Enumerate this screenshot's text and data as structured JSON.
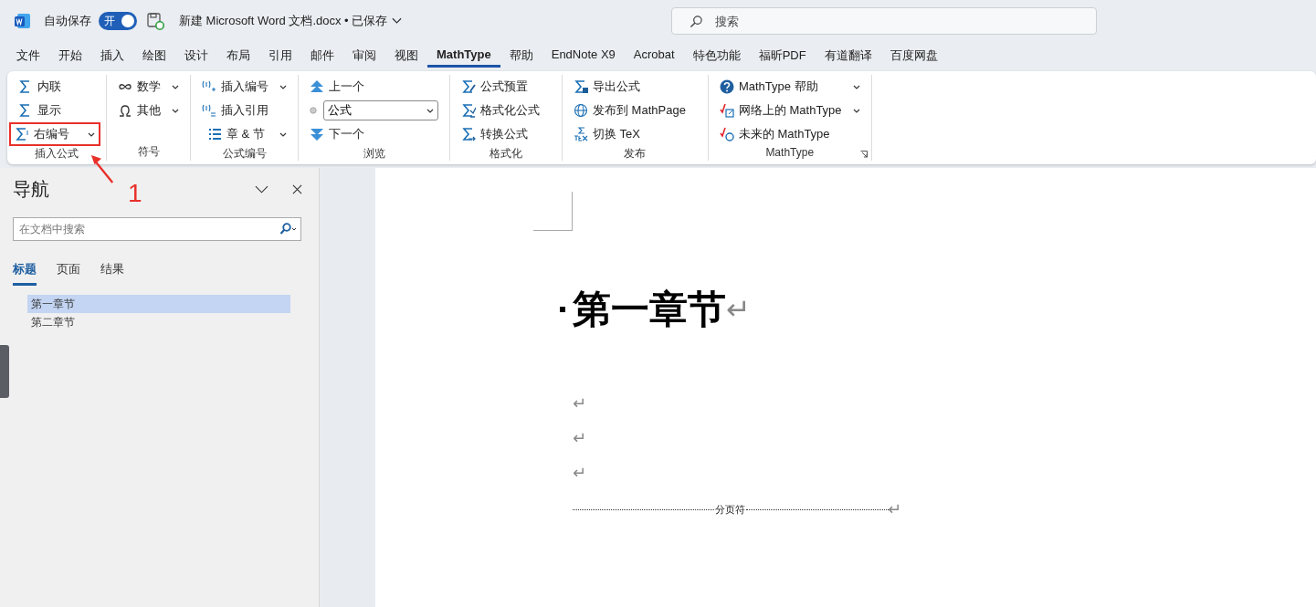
{
  "title_bar": {
    "autosave_label": "自动保存",
    "autosave": {
      "label": "开",
      "on": true
    },
    "document_title": "新建 Microsoft Word 文档.docx • 已保存",
    "search": {
      "placeholder": "搜索"
    }
  },
  "menu_tabs": [
    {
      "label": "文件",
      "selected": false
    },
    {
      "label": "开始",
      "selected": false
    },
    {
      "label": "插入",
      "selected": false
    },
    {
      "label": "绘图",
      "selected": false
    },
    {
      "label": "设计",
      "selected": false
    },
    {
      "label": "布局",
      "selected": false
    },
    {
      "label": "引用",
      "selected": false
    },
    {
      "label": "邮件",
      "selected": false
    },
    {
      "label": "审阅",
      "selected": false
    },
    {
      "label": "视图",
      "selected": false
    },
    {
      "label": "MathType",
      "selected": true
    },
    {
      "label": "帮助",
      "selected": false
    },
    {
      "label": "EndNote X9",
      "selected": false
    },
    {
      "label": "Acrobat",
      "selected": false
    },
    {
      "label": "特色功能",
      "selected": false
    },
    {
      "label": "福昕PDF",
      "selected": false
    },
    {
      "label": "有道翻译",
      "selected": false
    },
    {
      "label": "百度网盘",
      "selected": false
    }
  ],
  "ribbon": {
    "groups": [
      {
        "label": "插入公式",
        "launcher": false,
        "items": [
          {
            "kind": "button",
            "label": "内联",
            "has_menu": false,
            "annotated": false
          },
          {
            "kind": "button",
            "label": "显示",
            "has_menu": false,
            "annotated": false
          },
          {
            "kind": "button",
            "label": "右编号",
            "has_menu": true,
            "annotated": true
          }
        ]
      },
      {
        "label": "符号",
        "launcher": false,
        "items": [
          {
            "kind": "button",
            "label": "数学",
            "has_menu": true,
            "annotated": false
          },
          {
            "kind": "button",
            "label": "其他",
            "has_menu": true,
            "annotated": false
          }
        ]
      },
      {
        "label": "公式编号",
        "launcher": false,
        "items": [
          {
            "kind": "button",
            "label": "插入编号",
            "has_menu": true,
            "annotated": false
          },
          {
            "kind": "button",
            "label": "插入引用",
            "has_menu": false,
            "annotated": false
          },
          {
            "kind": "button",
            "label": "章 & 节",
            "has_menu": true,
            "annotated": false
          }
        ]
      },
      {
        "label": "浏览",
        "launcher": false,
        "items": [
          {
            "kind": "button",
            "label": "上一个",
            "has_menu": false,
            "annotated": false
          },
          {
            "kind": "combo",
            "label": "公式",
            "has_menu": true
          },
          {
            "kind": "button",
            "label": "下一个",
            "has_menu": false,
            "annotated": false
          }
        ]
      },
      {
        "label": "格式化",
        "launcher": false,
        "items": [
          {
            "kind": "button",
            "label": "公式预置",
            "has_menu": false,
            "annotated": false
          },
          {
            "kind": "button",
            "label": "格式化公式",
            "has_menu": false,
            "annotated": false
          },
          {
            "kind": "button",
            "label": "转换公式",
            "has_menu": false,
            "annotated": false
          }
        ]
      },
      {
        "label": "发布",
        "launcher": false,
        "items": [
          {
            "kind": "button",
            "label": "导出公式",
            "has_menu": false,
            "annotated": false
          },
          {
            "kind": "button",
            "label": "发布到 MathPage",
            "has_menu": false,
            "annotated": false
          },
          {
            "kind": "button",
            "label": "切换 TeX",
            "has_menu": false,
            "annotated": false
          }
        ]
      },
      {
        "label": "MathType",
        "launcher": true,
        "items": [
          {
            "kind": "button",
            "label": "MathType 帮助",
            "has_menu": true,
            "annotated": false
          },
          {
            "kind": "button",
            "label": "网络上的 MathType",
            "has_menu": true,
            "annotated": false
          },
          {
            "kind": "button",
            "label": "未来的 MathType",
            "has_menu": false,
            "annotated": false
          }
        ]
      }
    ]
  },
  "annotation": {
    "label": "1"
  },
  "navigation": {
    "title": "导航",
    "search": {
      "placeholder": "在文档中搜索"
    },
    "tabs": [
      {
        "label": "标题",
        "selected": true
      },
      {
        "label": "页面",
        "selected": false
      },
      {
        "label": "结果",
        "selected": false
      }
    ],
    "headings": [
      {
        "label": "第一章节",
        "selected": true
      },
      {
        "label": "第二章节",
        "selected": false
      }
    ]
  },
  "document": {
    "paragraphs": [
      {
        "kind": "heading",
        "text": "第一章节",
        "mark": "↵"
      },
      {
        "kind": "empty",
        "mark": "↵"
      },
      {
        "kind": "empty",
        "mark": "↵"
      },
      {
        "kind": "empty",
        "mark": "↵"
      },
      {
        "kind": "page_break",
        "text": "分页符",
        "mark": "↵"
      }
    ]
  }
}
